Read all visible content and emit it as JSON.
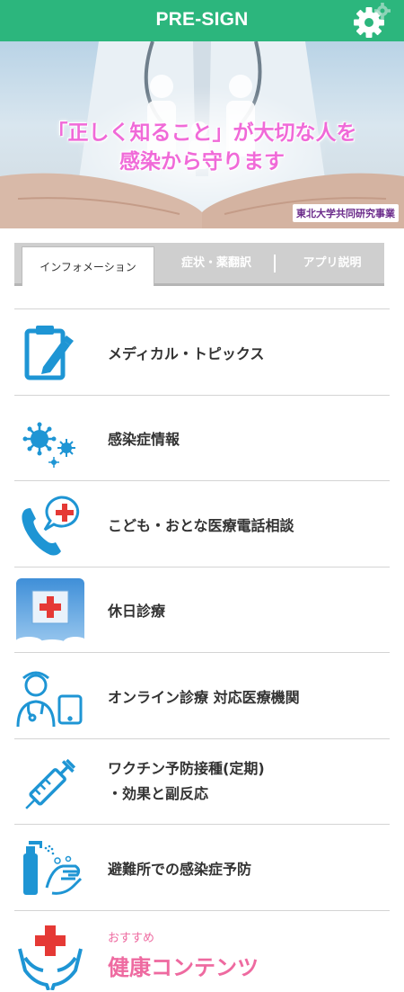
{
  "header": {
    "title": "PRE-SIGN",
    "settings_icon": "gear-icon"
  },
  "hero": {
    "line1": "「正しく知ること」が大切な人を",
    "line2": "感染から守ります",
    "badge": "東北大学共同研究事業"
  },
  "tabs": [
    {
      "label": "インフォメーション",
      "active": true
    },
    {
      "label": "症状・薬翻訳",
      "active": false
    },
    {
      "label": "アプリ説明",
      "active": false
    }
  ],
  "menu": [
    {
      "label": "メディカル・トピックス",
      "icon": "clipboard-pen-icon"
    },
    {
      "label": "感染症情報",
      "icon": "virus-icon"
    },
    {
      "label": "こども・おとな医療電話相談",
      "icon": "phone-medical-icon"
    },
    {
      "label": "休日診療",
      "icon": "hospital-flag-icon"
    },
    {
      "label": "オンライン診療 対応医療機関",
      "icon": "doctor-tablet-icon"
    },
    {
      "label_line1": "ワクチン予防接種(定期)",
      "label_line2": "・効果と副反応",
      "icon": "syringe-icon"
    },
    {
      "label": "避難所での感染症予防",
      "icon": "handwash-icon"
    },
    {
      "label_small": "おすすめ",
      "label_big": "健康コンテンツ",
      "icon": "hands-cross-icon"
    }
  ],
  "colors": {
    "header": "#2cb67d",
    "icon_blue": "#1e95d4",
    "cross_red": "#e53935",
    "accent_pink": "#ee6aa0"
  }
}
